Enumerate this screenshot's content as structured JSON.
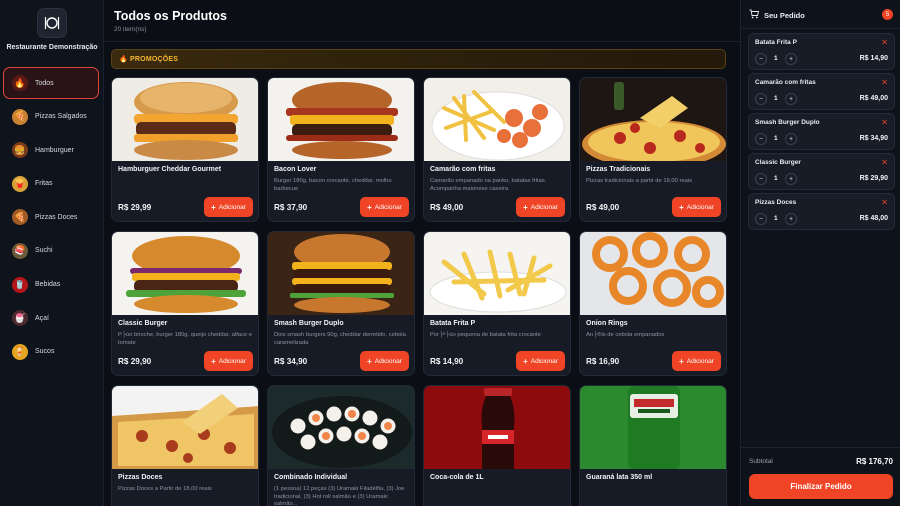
{
  "brand": {
    "name": "Restaurante Demonstração",
    "logo_icon": "restaurant-utensils-icon"
  },
  "categories": [
    {
      "label": "Todos",
      "icon": "fire-icon",
      "active": true
    },
    {
      "label": "Pizzas Salgados",
      "icon": "pizza-icon"
    },
    {
      "label": "Hamburguer",
      "icon": "burger-icon"
    },
    {
      "label": "Fritas",
      "icon": "fries-icon"
    },
    {
      "label": "Pizzas Doces",
      "icon": "sweet-pizza-icon"
    },
    {
      "label": "Suchi",
      "icon": "sushi-icon"
    },
    {
      "label": "Bebidas",
      "icon": "soda-icon"
    },
    {
      "label": "Açaí",
      "icon": "acai-icon"
    },
    {
      "label": "Sucos",
      "icon": "juice-icon"
    }
  ],
  "main": {
    "title": "Todos os Produtos",
    "subtitle": "20 item(ns)",
    "promo_label": "🔥 PROMOÇÕES",
    "add_label": "Adicionar",
    "products": [
      {
        "name": "Hamburguer Cheddar Gourmet",
        "desc": "",
        "price": "R$ 29,99"
      },
      {
        "name": "Bacon Lover",
        "desc": "Burger 180g, bacon crocante, cheddar, molho barbecue",
        "price": "R$ 37,90"
      },
      {
        "name": "Camarão com fritas",
        "desc": "Camarão empanado na panko, batatas fritas. Acompanha maionese caseira.",
        "price": "R$ 49,00"
      },
      {
        "name": "Pizzas Tradicionais",
        "desc": "Pizzas tradicionais a partir de 19,00 reais",
        "price": "R$ 49,00"
      },
      {
        "name": "Classic Burger",
        "desc": "P├úo brioche, burger 180g, queijo cheddar, alface e tomate",
        "price": "R$ 29,90"
      },
      {
        "name": "Smash Burger Duplo",
        "desc": "Dois smash burgers 90g, cheddar derretido, cebola caramelizada",
        "price": "R$ 34,90"
      },
      {
        "name": "Batata Frita P",
        "desc": "Por├º├úo pequena de batata frita crocante",
        "price": "R$ 14,90"
      },
      {
        "name": "Onion Rings",
        "desc": "An├®is de cebola empanados",
        "price": "R$ 16,90"
      },
      {
        "name": "Pizzas Doces",
        "desc": "Pizzas Doces a Partir de 18,00 reais",
        "price": ""
      },
      {
        "name": "Combinado Individual",
        "desc": "(1 pessoa) 12 peças (3) Uramaki Filadélfia, (3) Joe tradicional, (3) Hot roll salmão e (3) Uramaki salmão...",
        "price": ""
      },
      {
        "name": "Coca-cola de 1L",
        "desc": "",
        "price": ""
      },
      {
        "name": "Guaraná lata 350 ml",
        "desc": "",
        "price": ""
      }
    ]
  },
  "cart": {
    "title": "Seu Pedido",
    "count": "5",
    "items": [
      {
        "name": "Batata Frita P",
        "qty": "1",
        "price": "R$ 14,90"
      },
      {
        "name": "Camarão com fritas",
        "qty": "1",
        "price": "R$ 49,00"
      },
      {
        "name": "Smash Burger Duplo",
        "qty": "1",
        "price": "R$ 34,90"
      },
      {
        "name": "Classic Burger",
        "qty": "1",
        "price": "R$ 29,90"
      },
      {
        "name": "Pizzas Doces",
        "qty": "1",
        "price": "R$ 48,00"
      }
    ],
    "subtotal_label": "Subtotal",
    "subtotal_value": "R$ 176,70",
    "checkout_label": "Finalizar Pedido"
  },
  "colors": {
    "accent": "#ef4425",
    "promo_gold": "#f5b731",
    "bg": "#0b0e14"
  }
}
